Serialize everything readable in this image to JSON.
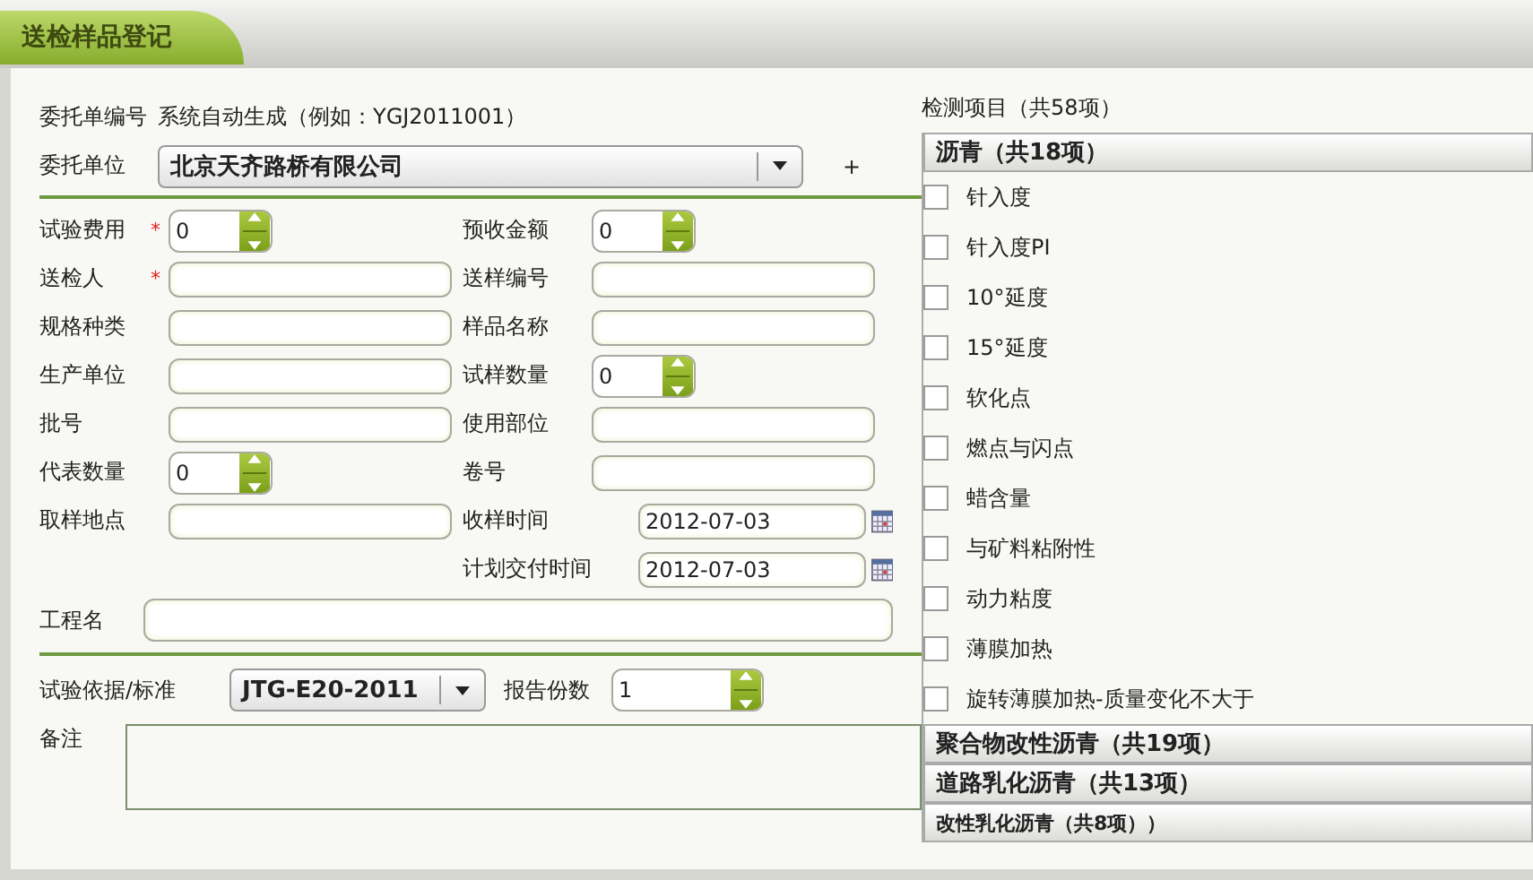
{
  "window": {
    "title": "送检样品登记"
  },
  "form": {
    "order_no": {
      "label": "委托单编号",
      "value": "系统自动生成（例如：YGJ2011001）"
    },
    "client": {
      "label": "委托单位",
      "value": "北京天齐路桥有限公司",
      "add": "+"
    },
    "rows": [
      {
        "left": {
          "label": "试验费用",
          "kind": "spinner",
          "value": "0",
          "required_mark": "*"
        },
        "right": {
          "label": "预收金额",
          "kind": "spinner",
          "value": "0"
        }
      },
      {
        "left": {
          "label": "送检人",
          "kind": "text",
          "required_mark": "*"
        },
        "right": {
          "label": "送样编号",
          "kind": "text"
        }
      },
      {
        "left": {
          "label": "规格种类",
          "kind": "text"
        },
        "right": {
          "label": "样品名称",
          "kind": "text"
        }
      },
      {
        "left": {
          "label": "生产单位",
          "kind": "text"
        },
        "right": {
          "label": "试样数量",
          "kind": "spinner",
          "value": "0"
        }
      },
      {
        "left": {
          "label": "批号",
          "kind": "text"
        },
        "right": {
          "label": "使用部位",
          "kind": "text"
        }
      },
      {
        "left": {
          "label": "代表数量",
          "kind": "spinner",
          "value": "0"
        },
        "right": {
          "label": "卷号",
          "kind": "text"
        }
      },
      {
        "left": {
          "label": "取样地点",
          "kind": "text"
        },
        "right": {
          "label": "收样时间",
          "kind": "date",
          "value": "2012-07-03"
        }
      },
      {
        "right": {
          "label": "计划交付时间",
          "kind": "date",
          "value": "2012-07-03"
        }
      }
    ],
    "project": {
      "label": "工程名"
    },
    "standard": {
      "label": "试验依据/标准",
      "value": "JTG-E20-2011"
    },
    "copies": {
      "label": "报告份数",
      "value": "1"
    },
    "remarks": {
      "label": "备注"
    }
  },
  "tests": {
    "title": "检测项目（共58项）",
    "groups": [
      {
        "title": "沥青（共18项）",
        "items": [
          {
            "label": "针入度",
            "checked": false
          },
          {
            "label": "针入度PI",
            "checked": false
          },
          {
            "label": "10°延度",
            "checked": false
          },
          {
            "label": "15°延度",
            "checked": false
          },
          {
            "label": "软化点",
            "checked": false
          },
          {
            "label": "燃点与闪点",
            "checked": false
          },
          {
            "label": "蜡含量",
            "checked": false
          },
          {
            "label": "与矿料粘附性",
            "checked": false
          },
          {
            "label": "动力粘度",
            "checked": false
          },
          {
            "label": "薄膜加热",
            "checked": false
          },
          {
            "label": "旋转薄膜加热-质量变化不大于",
            "checked": false
          }
        ]
      },
      {
        "title": "聚合物改性沥青（共19项）"
      },
      {
        "title": "道路乳化沥青（共13项）"
      },
      {
        "title": "改性乳化沥青（共8项））"
      }
    ]
  }
}
